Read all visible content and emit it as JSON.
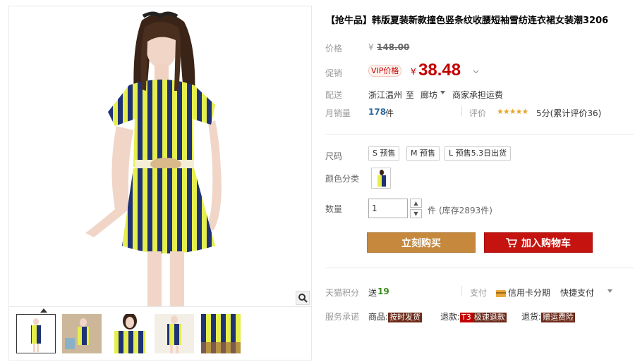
{
  "product": {
    "title": "【抢牛品】韩版夏装新款撞色竖条纹收腰短袖雪纺连衣裙女装潮3206"
  },
  "price": {
    "label": "价格",
    "currency": "¥",
    "original": "148.00"
  },
  "promo": {
    "label": "促销",
    "vip_tag": "VIP价格",
    "currency": "¥",
    "price": "38.48"
  },
  "delivery": {
    "label": "配送",
    "from": "浙江温州",
    "to_word": "至",
    "destination": "廊坊",
    "freight": "商家承担运费"
  },
  "sales": {
    "label": "月销量",
    "count": "178",
    "unit": "件",
    "review_label": "评价",
    "stars": "★★★★★",
    "score_text": "5分(累计评价36)"
  },
  "sku": {
    "label": "尺码",
    "options": [
      "S 预售",
      "M 预售",
      "L 预售5.3日出货"
    ],
    "color_label": "颜色分类"
  },
  "quantity": {
    "label": "数量",
    "value": "1",
    "unit": "件",
    "stock": "(库存2893件)"
  },
  "buttons": {
    "buy": "立刻购买",
    "cart": "加入购物车"
  },
  "points": {
    "label": "天猫积分",
    "prefix": "送",
    "value": "19"
  },
  "payment": {
    "label": "支付",
    "card": "信用卡分期",
    "quick": "快捷支付"
  },
  "service": {
    "label": "服务承诺",
    "item1_prefix": "商品:",
    "item1_badge": "按时发货",
    "item2_prefix": "退款:",
    "item2_badge_red": "T3",
    "item2_badge": "极速退款",
    "item3_prefix": "退货:",
    "item3_badge": "赠运费险"
  },
  "colors": {
    "price_red": "#c40000",
    "buy_button": "#c5883c",
    "cart_button": "#c5130f",
    "count_blue": "#2e6b9e",
    "points_green": "#3a8a1a"
  },
  "icons": [
    "zoom-icon",
    "cart-icon",
    "credit-card-icon",
    "chevron-down-icon"
  ]
}
